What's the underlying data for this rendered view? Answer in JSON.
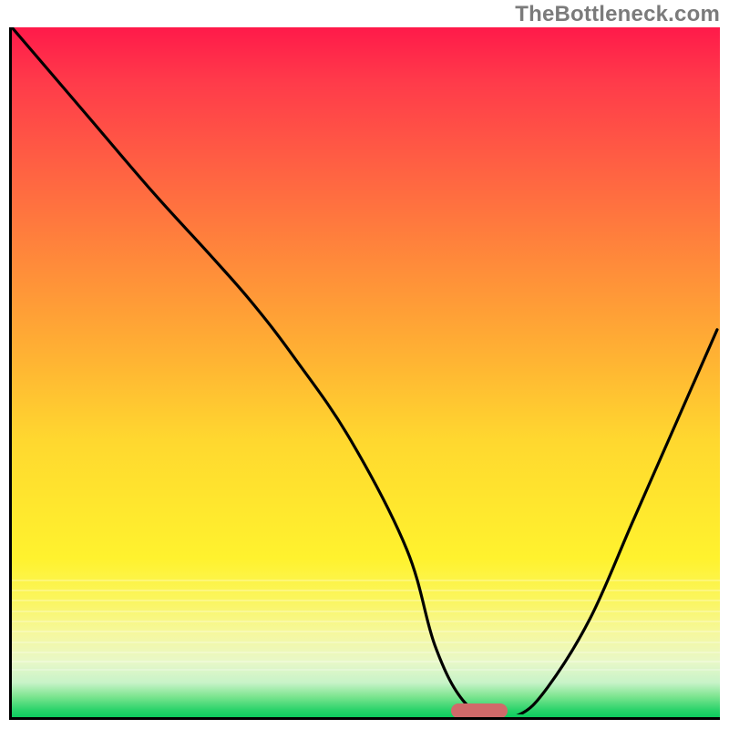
{
  "watermark": "TheBottleneck.com",
  "colors": {
    "gradient_top": "#ff1a4a",
    "gradient_mid": "#ffd82f",
    "gradient_bottom": "#0ccc5e",
    "axis": "#000000",
    "curve": "#000000",
    "marker": "#d06a6a",
    "watermark_text": "#7b7b7b"
  },
  "chart_data": {
    "type": "line",
    "title": "",
    "xlabel": "",
    "ylabel": "",
    "xlim": [
      0,
      100
    ],
    "ylim": [
      0,
      100
    ],
    "grid": false,
    "annotations": [
      "TheBottleneck.com"
    ],
    "marker": {
      "x_start": 62,
      "x_end": 70,
      "y": 0
    },
    "series": [
      {
        "name": "curve",
        "x": [
          0,
          10,
          20,
          28,
          34,
          40,
          48,
          56,
          60,
          64,
          68,
          72,
          76,
          82,
          88,
          94,
          100
        ],
        "y": [
          100,
          88,
          76,
          67,
          60,
          52,
          40,
          24,
          10,
          2,
          0,
          0,
          4,
          14,
          28,
          42,
          56
        ]
      }
    ]
  }
}
